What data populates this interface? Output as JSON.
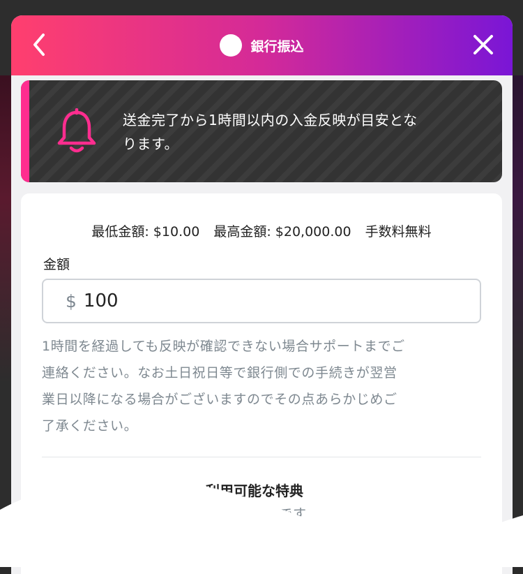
{
  "header": {
    "title": "銀行振込",
    "back_icon": "chevron-left-icon",
    "close_icon": "close-icon"
  },
  "notice": {
    "icon": "bell-icon",
    "text_line1": "送金完了から1時間以内の入金反映が目安とな",
    "text_line2": "ります。"
  },
  "limits": {
    "min": "最低金額: $10.00",
    "max": "最高金額: $20,000.00",
    "fee": "手数料無料"
  },
  "amount": {
    "label": "金額",
    "currency": "$",
    "value": "100"
  },
  "help": {
    "line1": "1時間を経過しても反映が確認できない場合サポートまでご",
    "line2": "連絡ください。なお土日祝日等で銀行側での手続きが翌営",
    "line3": "業日以降になる場合がございますのでその点あらかじめご",
    "line4": "了承ください。"
  },
  "benefits": {
    "title": "利用可能な特典",
    "subtitle": "選択可能です"
  },
  "colors": {
    "header_start": "#ff3f6e",
    "header_end": "#7a16d6",
    "notice_accent": "#ff2d8f",
    "notice_bg": "#333333"
  }
}
